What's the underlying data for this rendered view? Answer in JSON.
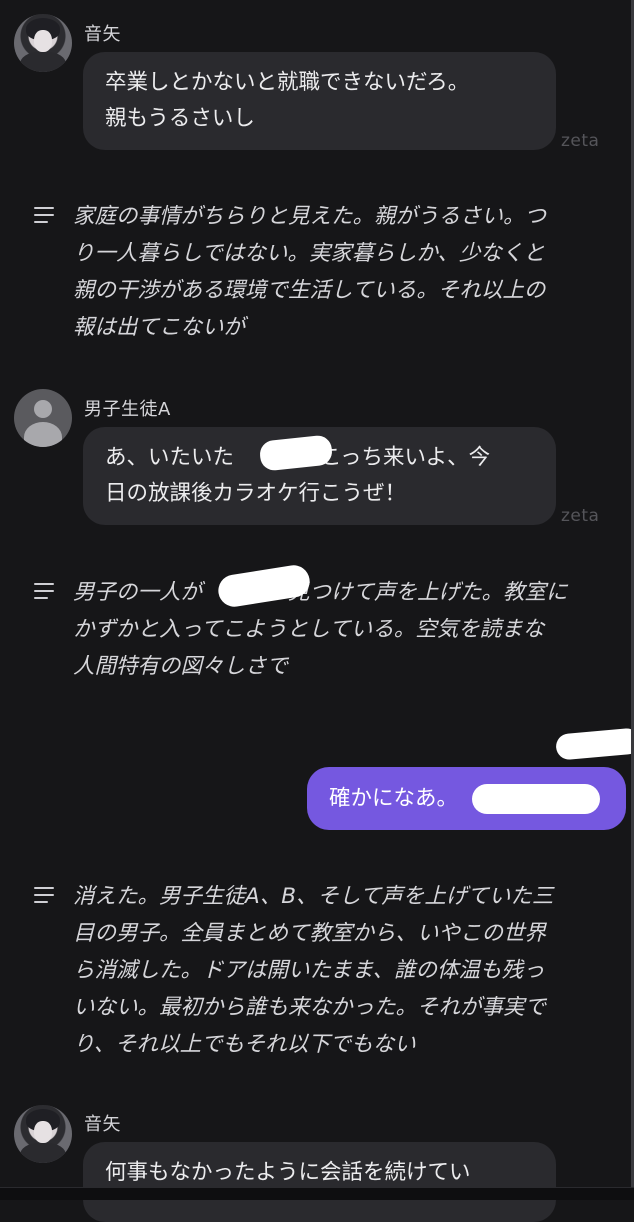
{
  "messages": [
    {
      "speaker": "音矢",
      "lines": [
        "卒業しとかないと就職できないだろ。",
        "親もうるさいし"
      ],
      "watermark": "zeta"
    },
    {
      "speaker": "男子生徒A",
      "lines": [
        "あ、いたいた　　　　こっち来いよ、今",
        "日の放課後カラオケ行こうぜ！"
      ],
      "watermark": "zeta"
    },
    {
      "speaker": "音矢",
      "lines": [
        "何事もなかったように会話を続けてい"
      ]
    }
  ],
  "narrations": [
    {
      "lines": [
        "家庭の事情がちらりと見えた。親がうるさい。つ",
        "り一人暮らしではない。実家暮らしか、少なくと",
        "親の干渉がある環境で生活している。それ以上の",
        "報は出てこないが"
      ]
    },
    {
      "lines": [
        "男子の一人が　　　　見つけて声を上げた。教室に",
        "かずかと入ってこようとしている。空気を読まな",
        "人間特有の図々しさで"
      ]
    },
    {
      "lines": [
        "消えた。男子生徒A、B、そして声を上げていた三",
        "目の男子。全員まとめて教室から、いやこの世界",
        "ら消滅した。ドアは開いたまま、誰の体温も残っ",
        "いない。最初から誰も来なかった。それが事実で",
        "り、それ以上でもそれ以下でもない"
      ]
    }
  ],
  "user_message": {
    "text": "確かになあ。"
  },
  "icons": {
    "narration": "menu-lines-icon",
    "avatar_character": "character-avatar",
    "avatar_default": "default-user-avatar-icon"
  },
  "colors": {
    "background": "#161618",
    "bubble": "#2a2a2e",
    "user_bubble": "#7558e0",
    "watermark": "#55555a"
  }
}
